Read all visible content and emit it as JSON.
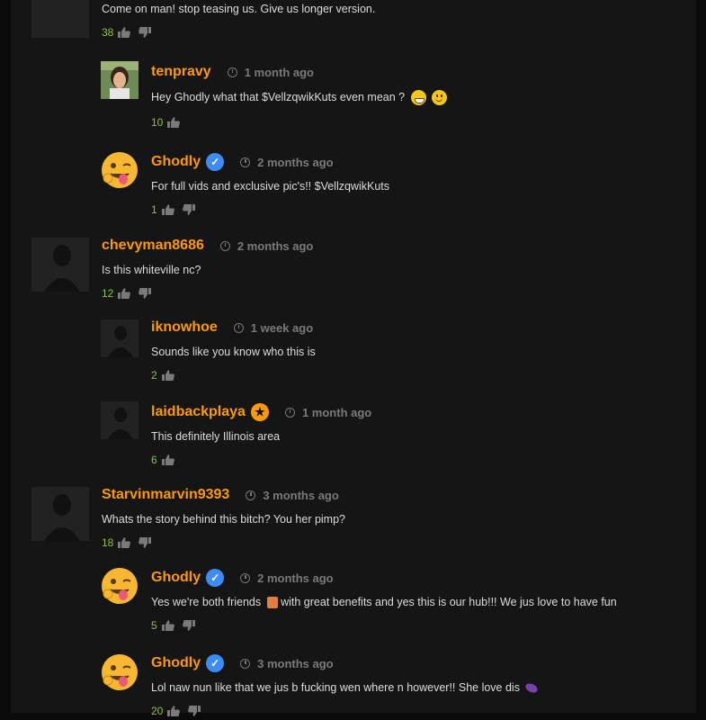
{
  "comments": [
    {
      "kind": "top",
      "username": "",
      "time": "",
      "text": "Come on man! stop teasing us. Give us longer version.",
      "likes": "38",
      "avatar": "placeholder",
      "badge": "",
      "emojis": [],
      "has_dislike": true
    },
    {
      "kind": "reply",
      "username": "tenpravy",
      "time": "1 month ago",
      "text": "Hey Ghodly what that $VellzqwikKuts even mean ?",
      "likes": "10",
      "avatar": "photo",
      "badge": "",
      "emojis": [
        "grinning-face-emoji",
        "smiling-face-emoji"
      ],
      "has_dislike": false
    },
    {
      "kind": "reply",
      "username": "Ghodly",
      "time": "2 months ago",
      "text": "For full vids and exclusive pic's!! $VellzqwikKuts",
      "likes": "1",
      "avatar": "winking-tongue-emoji",
      "badge": "verified",
      "emojis": [],
      "has_dislike": true
    },
    {
      "kind": "top",
      "username": "chevyman8686",
      "time": "2 months ago",
      "text": "Is this whiteville nc?",
      "likes": "12",
      "avatar": "placeholder",
      "badge": "",
      "emojis": [],
      "has_dislike": true
    },
    {
      "kind": "reply",
      "username": "iknowhoe",
      "time": "1 week ago",
      "text": "Sounds like you know who this is",
      "likes": "2",
      "avatar": "placeholder",
      "badge": "",
      "emojis": [],
      "has_dislike": false
    },
    {
      "kind": "reply",
      "username": "laidbackplaya",
      "time": "1 month ago",
      "text": "This definitely Illinois area",
      "likes": "6",
      "avatar": "placeholder",
      "badge": "star",
      "emojis": [],
      "has_dislike": false
    },
    {
      "kind": "top",
      "username": "Starvinmarvin9393",
      "time": "3 months ago",
      "text": "Whats the story behind this bitch? You her pimp?",
      "likes": "18",
      "avatar": "placeholder",
      "badge": "",
      "emojis": [],
      "has_dislike": true
    },
    {
      "kind": "reply",
      "username": "Ghodly",
      "time": "2 months ago",
      "text_before": "Yes we're both friends",
      "text_after": "with great benefits and yes this is our hub!!! We jus love to have fun",
      "likes": "5",
      "avatar": "winking-tongue-emoji",
      "badge": "verified",
      "emojis": [
        "people-holding-hands-emoji"
      ],
      "has_dislike": true
    },
    {
      "kind": "reply",
      "username": "Ghodly",
      "time": "3 months ago",
      "text": "Lol naw nun like that we jus b fucking wen where n however!! She love dis",
      "likes": "20",
      "avatar": "winking-tongue-emoji",
      "badge": "verified",
      "emojis": [
        "eggplant-emoji"
      ],
      "has_dislike": true
    }
  ],
  "colors": {
    "background": "#151515",
    "username": "#ff9900",
    "likes": "#8ac33f",
    "time": "#7a7a7a",
    "text": "#dcdcdc",
    "verified": "#3b8cf4"
  }
}
